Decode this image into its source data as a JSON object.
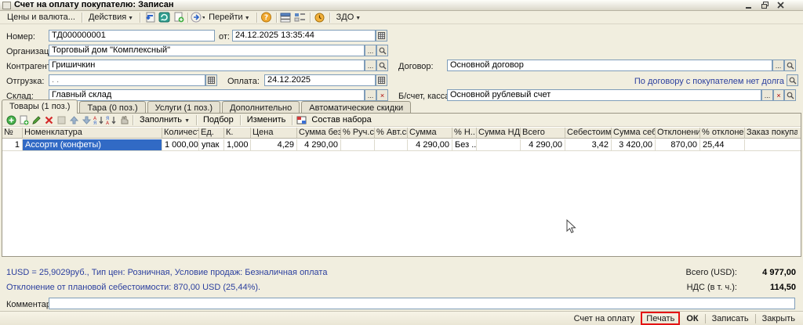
{
  "window": {
    "title": "Счет на оплату покупателю: Записан"
  },
  "toolbar": {
    "prices_currency": "Цены и валюта...",
    "actions": "Действия",
    "go": "Перейти",
    "zdo": "ЗДО"
  },
  "form": {
    "number_label": "Номер:",
    "number": "ТД000000001",
    "from_label": "от:",
    "date": "24.12.2025 13:35:44",
    "org_label": "Организация:",
    "org": "Торговый дом \"Комплексный\"",
    "contractor_label": "Контрагент:",
    "contractor": "Гришичкин",
    "shipment_label": "Отгрузка:",
    "shipment": ". .",
    "payment_label": "Оплата:",
    "payment": "24.12.2025",
    "warehouse_label": "Склад:",
    "warehouse": "Главный склад",
    "contract_label": "Договор:",
    "contract": "Основной договор",
    "no_debt": "По договору с покупателем нет долга",
    "account_label": "Б/счет, касса:",
    "account": "Основной рублевый счет"
  },
  "tabs": [
    {
      "label": "Товары (1 поз.)"
    },
    {
      "label": "Тара (0 поз.)"
    },
    {
      "label": "Услуги (1 поз.)"
    },
    {
      "label": "Дополнительно"
    },
    {
      "label": "Автоматические скидки"
    }
  ],
  "grid_toolbar": {
    "fill": "Заполнить",
    "pick": "Подбор",
    "change": "Изменить",
    "set_content": "Состав набора"
  },
  "table": {
    "columns": [
      "№",
      "Номенклатура",
      "Количест..",
      "Ед.",
      "К.",
      "Цена",
      "Сумма без ..",
      "% Руч.ск.",
      "% Авт.ск.",
      "Сумма",
      "% Н..",
      "Сумма НДС",
      "Всего",
      "Себестоимо..",
      "Сумма себе..",
      "Отклонение",
      "% отклонения",
      "Заказ покупате.."
    ],
    "row": [
      "1",
      "Ассорти (конфеты)",
      "1 000,000",
      "упак",
      "1,000",
      "4,29",
      "4 290,00",
      "",
      "",
      "4 290,00",
      "Без ..",
      "",
      "4 290,00",
      "3,42",
      "3 420,00",
      "870,00",
      "25,44",
      ""
    ]
  },
  "footer": {
    "rate_line": "1USD = 25,9029руб., Тип цен: Розничная, Условие продаж: Безналичная оплата",
    "deviation_line": "Отклонение от плановой себестоимости: 870,00 USD (25,44%).",
    "total_label": "Всего (USD):",
    "total": "4 977,00",
    "vat_label": "НДС (в т. ч.):",
    "vat": "114,50",
    "comment_label": "Комментарий:"
  },
  "buttons": {
    "invoice": "Счет на оплату",
    "print": "Печать",
    "ok": "ОК",
    "save": "Записать",
    "close": "Закрыть"
  },
  "colors": {
    "selection": "#316ac5",
    "info_text": "#2b3f9e",
    "highlight_box": "#e41414"
  }
}
